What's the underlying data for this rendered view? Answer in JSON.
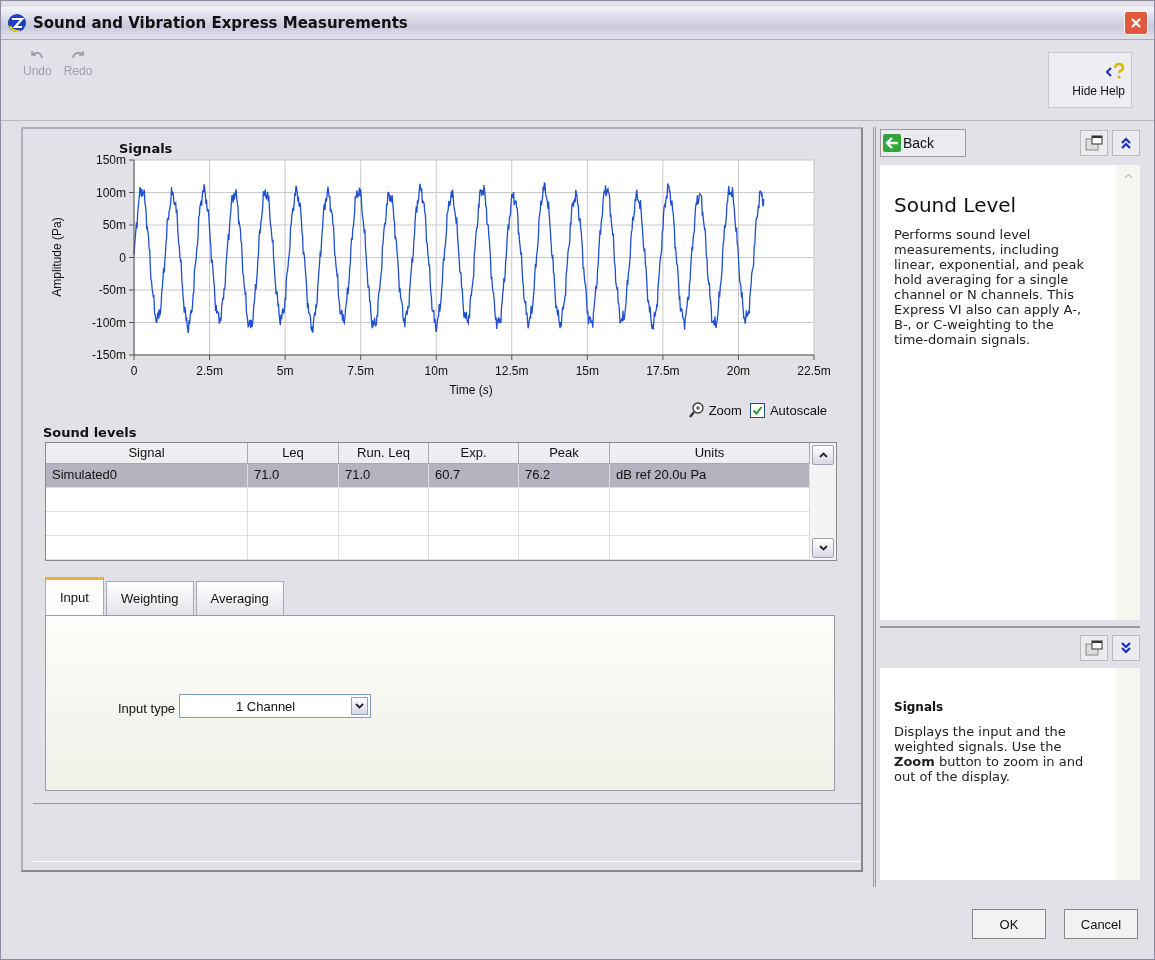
{
  "window": {
    "title": "Sound and Vibration Express Measurements"
  },
  "toolbar": [
    {
      "label": "Undo",
      "kind": "undo",
      "disabled": true
    },
    {
      "label": "Redo",
      "kind": "redo",
      "disabled": true
    }
  ],
  "help_toggle": {
    "label": "Hide Help"
  },
  "graph": {
    "title": "Signals",
    "ylabel": "Amplitude (Pa)",
    "xlabel": "Time (*s*)",
    "yticks": [
      "150m",
      "100m",
      "50m",
      "0",
      "-50m",
      "-100m",
      "-150m"
    ],
    "xticks": [
      "0",
      "2.5m",
      "5m",
      "7.5m",
      "10m",
      "12.5m",
      "15m",
      "17.5m",
      "20m",
      "22.5m"
    ]
  },
  "graph_controls": {
    "zoom": "Zoom",
    "autoscale": {
      "label": "Autoscale",
      "checked": true
    }
  },
  "table": {
    "title": "Sound levels",
    "columns": [
      "Signal",
      "Leq",
      "Run. Leq",
      "Exp.",
      "Peak",
      "Units"
    ],
    "rows": [
      {
        "selected": true,
        "cells": [
          "Simulated0",
          "71.0",
          "71.0",
          "60.7",
          "76.2",
          "dB ref 20.0u Pa"
        ]
      }
    ]
  },
  "tabs": [
    {
      "label": "Input",
      "selected": true
    },
    {
      "label": "Weighting",
      "selected": false
    },
    {
      "label": "Averaging",
      "selected": false
    }
  ],
  "input_type": {
    "label": "Input type",
    "value": "1 Channel"
  },
  "help": {
    "back": "Back",
    "title": "Sound Level",
    "body": "Performs sound level measurements, including linear, exponential, and peak hold averaging for a single channel or N channels. This Express VI also can apply A-, B-, or C-weighting to the time-domain signals.",
    "context_title": "Signals",
    "context_body": "Displays the input and the weighted signals. Use the **Zoom** button to zoom in and out of the display."
  },
  "buttons": [
    "OK",
    "Cancel"
  ]
}
